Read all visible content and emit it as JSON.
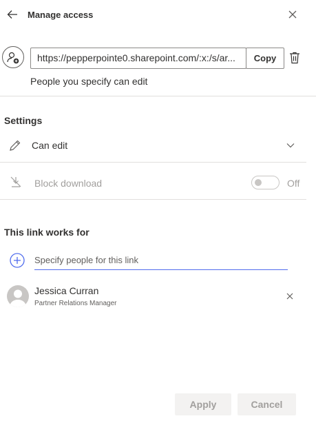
{
  "header": {
    "title": "Manage access"
  },
  "link": {
    "url": "https://pepperpointe0.sharepoint.com/:x:/s/ar...",
    "copy_label": "Copy",
    "permission_text": "People you specify can edit"
  },
  "settings": {
    "title": "Settings",
    "permission_value": "Can edit",
    "block_download_label": "Block download",
    "block_download_state": "Off"
  },
  "audience": {
    "title": "This link works for",
    "specify_placeholder": "Specify people for this link",
    "people": [
      {
        "name": "Jessica Curran",
        "job_title": "Partner Relations Manager"
      }
    ]
  },
  "footer": {
    "apply_label": "Apply",
    "cancel_label": "Cancel"
  },
  "colors": {
    "accent": "#4f6bed",
    "disabled_text": "#a19f9d",
    "divider": "#e1dfdd"
  }
}
